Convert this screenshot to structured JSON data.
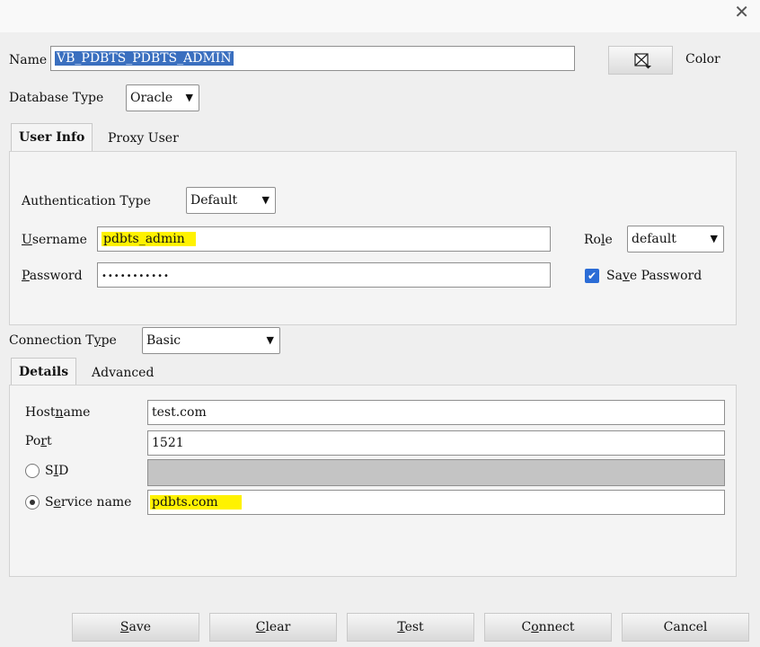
{
  "window": {
    "close_glyph": "✕"
  },
  "name": {
    "label": "Name",
    "value": "VB_PDBTS_PDBTS_ADMIN"
  },
  "color": {
    "label": "Color"
  },
  "database_type": {
    "label": "Database Type",
    "value": "Oracle"
  },
  "user_tabs": [
    {
      "label": "User Info",
      "active": true
    },
    {
      "label": "Proxy User",
      "active": false
    }
  ],
  "auth": {
    "label": "Authentication Type",
    "value": "Default"
  },
  "username": {
    "label_pre": "",
    "label_u": "U",
    "label_post": "sername",
    "value": "pdbts_admin"
  },
  "password": {
    "label_u": "P",
    "label_post": "assword",
    "value": "•••••••••••"
  },
  "role": {
    "label_pre": "Ro",
    "label_u": "l",
    "label_post": "e",
    "value": "default"
  },
  "save_password": {
    "pre": "Sa",
    "u": "v",
    "post": "e Password",
    "checked": true
  },
  "connection_type": {
    "pre": "Connection T",
    "u": "y",
    "post": "pe",
    "value": "Basic"
  },
  "detail_tabs": [
    {
      "label": "Details",
      "active": true
    },
    {
      "label": "Advanced",
      "active": false
    }
  ],
  "hostname": {
    "pre": "Host",
    "u": "n",
    "post": "ame",
    "value": "test.com"
  },
  "port": {
    "pre": "Po",
    "u": "r",
    "post": "t",
    "value": "1521"
  },
  "sid": {
    "pre": "S",
    "u": "I",
    "post": "D",
    "value": ""
  },
  "service_name": {
    "pre": "S",
    "u": "e",
    "post": "rvice name",
    "value": "pdbts.com"
  },
  "buttons": {
    "save": {
      "u": "S",
      "post": "ave"
    },
    "clear": {
      "u": "C",
      "post": "lear"
    },
    "test": {
      "u": "T",
      "post": "est"
    },
    "connect": {
      "pre": "C",
      "u": "o",
      "post": "nnect"
    },
    "cancel": {
      "label": "Cancel"
    }
  },
  "icons": {
    "color": "color-picker-icon",
    "dropdown": "chevron-down-icon",
    "check": "checkmark-icon"
  },
  "colors": {
    "highlight": "#fff200",
    "selection": "#3a6fbf",
    "checkbox": "#2b6cd6"
  }
}
